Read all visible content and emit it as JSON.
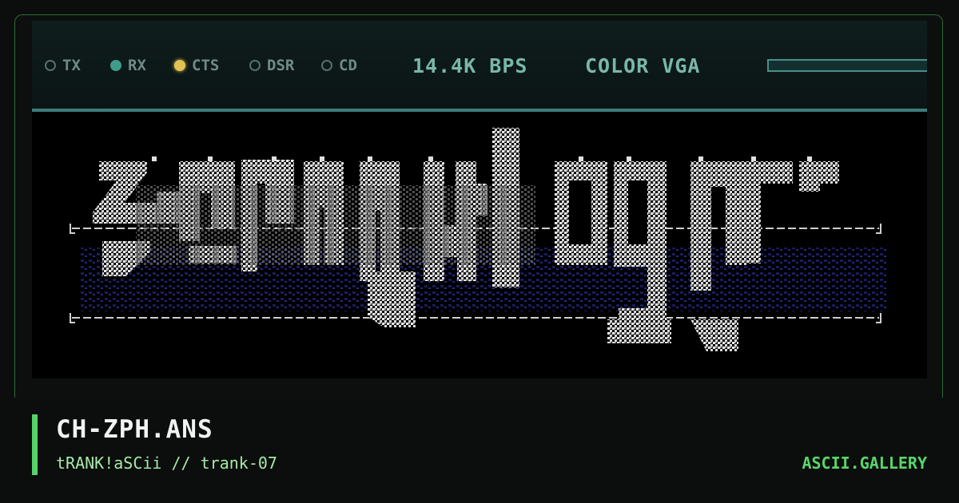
{
  "status_bar": {
    "indicators": [
      {
        "label": "TX",
        "state": "off"
      },
      {
        "label": "RX",
        "state": "on",
        "color": "#3f9d8a"
      },
      {
        "label": "CTS",
        "state": "on",
        "color": "#e2c154"
      },
      {
        "label": "DSR",
        "state": "off"
      },
      {
        "label": "CD",
        "state": "off"
      }
    ],
    "speed": "14.4K BPS",
    "display_mode": "COLOR VGA"
  },
  "artwork": {
    "description_icon": "ascii-art-logo",
    "colors": {
      "primary": "#e8e8e8",
      "shadow": "#1c1f6a",
      "frame": "#cfcfcf"
    }
  },
  "caption": {
    "title": "CH-ZPH.ANS",
    "subtitle": "tRANK!aSCii // trank-07",
    "brand": "ASCII.GALLERY",
    "accent_color": "#56d36a"
  }
}
